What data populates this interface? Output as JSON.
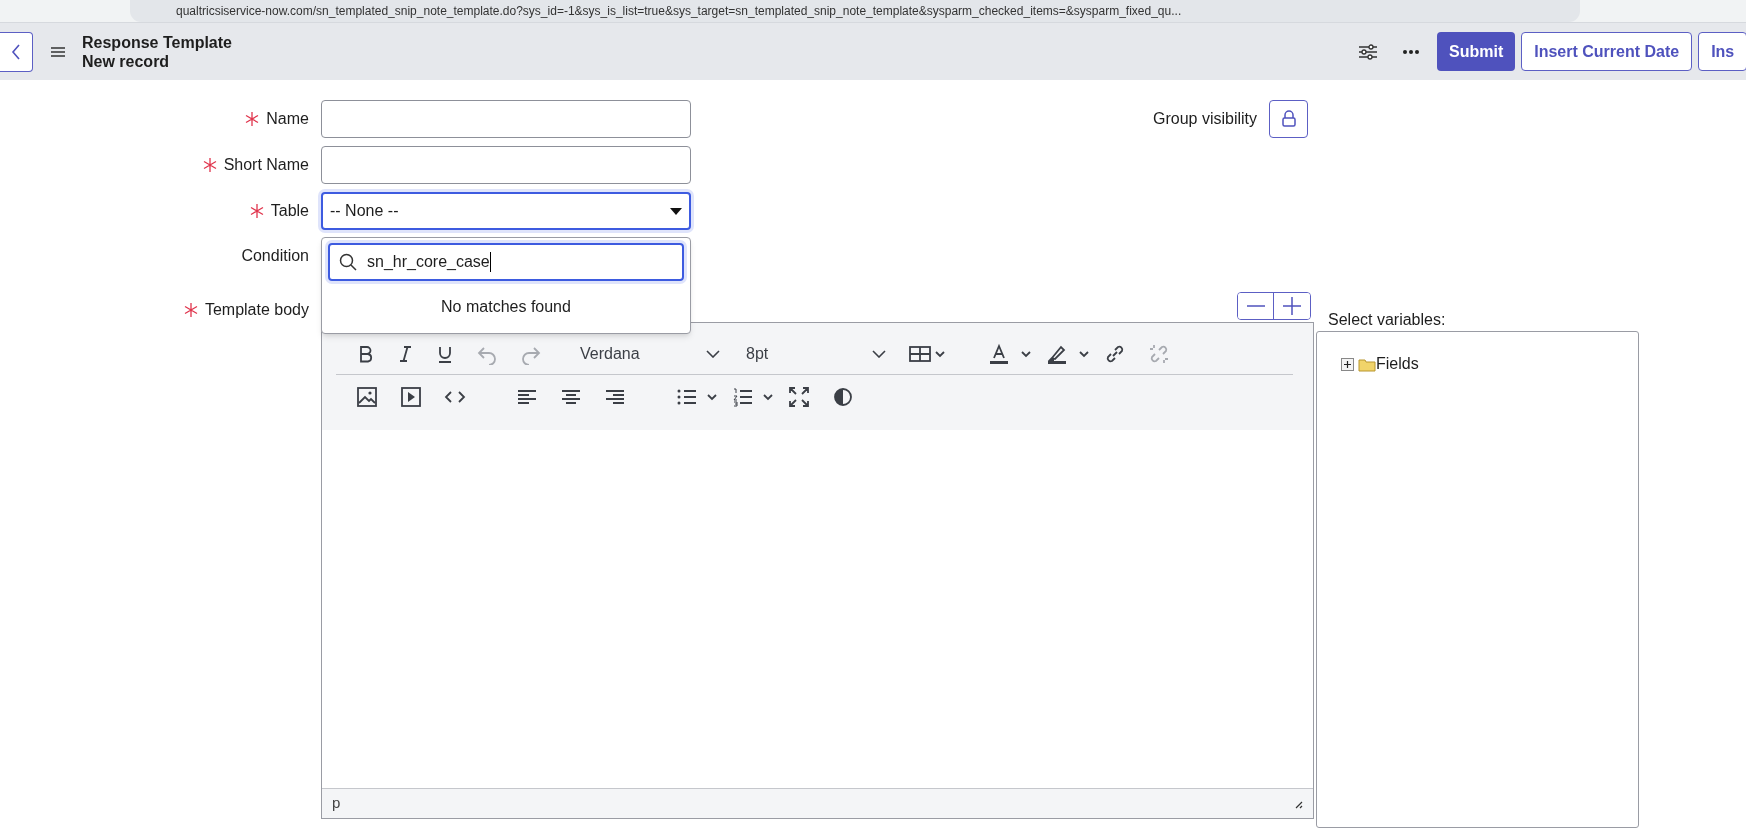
{
  "browser": {
    "url": "qualtricsiservice-now.com/sn_templated_snip_note_template.do?sys_id=-1&sys_is_list=true&sys_target=sn_templated_snip_note_template&sysparm_checked_items=&sysparm_fixed_qu..."
  },
  "header": {
    "title": "Response Template",
    "subtitle": "New record",
    "buttons": [
      {
        "label": "Submit",
        "primary": true
      },
      {
        "label": "Insert Current Date",
        "primary": false
      },
      {
        "label": "Ins",
        "primary": false
      }
    ]
  },
  "form": {
    "fields": [
      {
        "label": "Name",
        "required": true,
        "kind": "text"
      },
      {
        "label": "Short Name",
        "required": true,
        "kind": "text"
      },
      {
        "label": "Table",
        "required": true,
        "kind": "select",
        "value": "-- None --",
        "focused": true
      },
      {
        "label": "Condition",
        "required": false,
        "kind": "condition"
      },
      {
        "label": "Template body",
        "required": true,
        "kind": "editor"
      }
    ]
  },
  "table_dropdown": {
    "search_value": "sn_hr_core_case",
    "message": "No matches found"
  },
  "group_visibility": {
    "label": "Group visibility"
  },
  "editor": {
    "font_family": "Verdana",
    "font_size": "8pt",
    "status": "p",
    "tools": [
      {
        "disabled": false
      },
      {
        "disabled": false
      },
      {
        "disabled": false
      },
      {
        "disabled": true
      },
      {
        "disabled": true
      },
      {
        "disabled": false
      },
      {
        "disabled": false
      },
      {
        "disabled": false
      },
      {
        "disabled": false
      },
      {
        "disabled": true
      },
      {
        "disabled": false
      },
      {
        "disabled": false
      },
      {
        "disabled": false
      },
      {
        "disabled": false
      },
      {
        "disabled": false
      },
      {
        "disabled": false
      },
      {
        "disabled": false
      },
      {
        "disabled": false
      },
      {
        "disabled": false
      },
      {
        "disabled": false
      }
    ]
  },
  "variables": {
    "label": "Select variables:",
    "tree": [
      {
        "label": "Fields",
        "expanded": false
      }
    ]
  }
}
